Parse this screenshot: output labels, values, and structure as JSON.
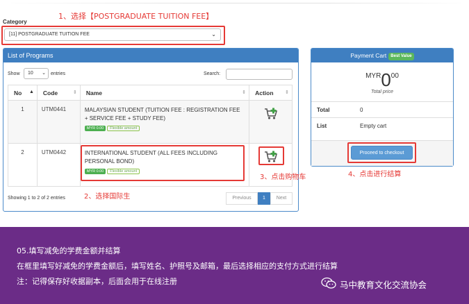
{
  "annotations": {
    "step1": "1、选择【POSTGRADUATE TUITION FEE】",
    "step2": "2、选择国际生",
    "step3": "3、点击购物车",
    "step4": "4、点击进行结算"
  },
  "category": {
    "label": "Category",
    "selected": "[11] POSTGRADUATE TUITION FEE"
  },
  "programs": {
    "title": "List of Programs",
    "show_label": "Show",
    "page_length": "10",
    "entries_label": "entries",
    "search_label": "Search:",
    "columns": [
      "No",
      "Code",
      "Name",
      "Action"
    ],
    "rows": [
      {
        "no": "1",
        "code": "UTM0441",
        "name": "MALAYSIAN STUDENT (TUITION FEE : REGISTRATION FEE + SERVICE FEE + STUDY FEE)",
        "price": "MYR 0.00",
        "flex": "Flexible amount"
      },
      {
        "no": "2",
        "code": "UTM0442",
        "name": "INTERNATIONAL STUDENT (ALL FEES INCLUDING PERSONAL BOND)",
        "price": "MYR 0.00",
        "flex": "Flexible amount"
      }
    ],
    "info": "Showing 1 to 2 of 2 entries",
    "pager": {
      "previous": "Previous",
      "current": "1",
      "next": "Next"
    }
  },
  "cart": {
    "title": "Payment Cart",
    "badge": "Best Value",
    "currency": "MYR",
    "amount_int": "0",
    "amount_dec": "00",
    "total_caption": "Total price",
    "total_label": "Total",
    "total_value": "0",
    "list_label": "List",
    "list_value": "Empty cart",
    "checkout_label": "Proceed to checkout"
  },
  "footer": {
    "line1": "05.填写减免的学费金额并结算",
    "line2": "在框里填写好减免的学费金额后，填写姓名、护照号及邮箱，最后选择相应的支付方式进行结算",
    "line3": "注：记得保存好收据副本，后面会用于在线注册",
    "org": "马中教育文化交流协会"
  },
  "colors": {
    "accent": "#3f7fc1",
    "annotation": "#e53935",
    "footer_bg": "#6b2c87",
    "success": "#4caf50"
  }
}
